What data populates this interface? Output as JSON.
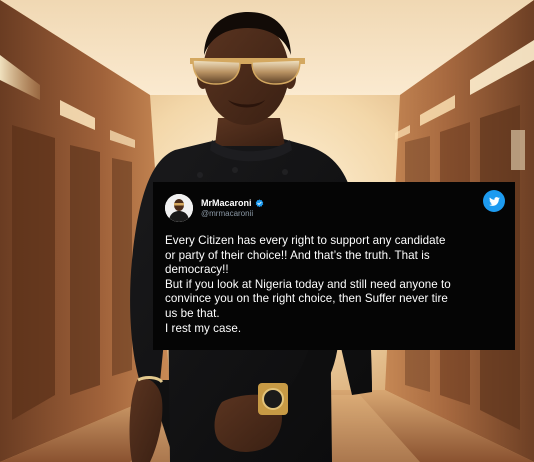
{
  "tweet": {
    "display_name": "MrMacaroni",
    "handle": "@mrmacaronii",
    "verified": true,
    "body_lines": [
      "Every Citizen has every right to support any candidate",
      "or party of their choice!! And that’s the truth. That is",
      "democracy!!",
      "But if you look at Nigeria today and still need anyone to",
      "convince you on the right choice, then Suffer never tire",
      "us be that.",
      "I rest my case."
    ],
    "icons": {
      "verified": "verified-badge-icon",
      "platform": "twitter-bird-icon"
    }
  },
  "colors": {
    "card_background": "#050505",
    "handle_text": "#8b98a5",
    "twitter_blue": "#1d9bf0",
    "body_text": "#ffffff"
  }
}
